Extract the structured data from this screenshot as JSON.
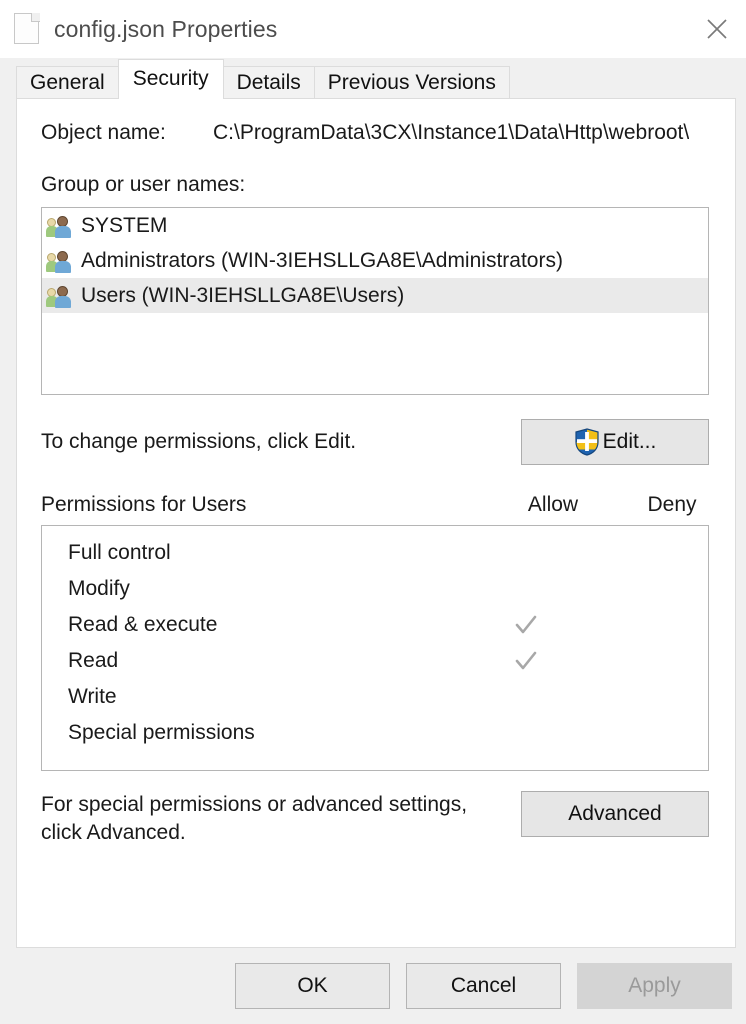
{
  "window": {
    "title": "config.json Properties",
    "file_icon": "document-icon",
    "close_icon": "close-icon"
  },
  "tabs": [
    {
      "label": "General",
      "active": false
    },
    {
      "label": "Security",
      "active": true
    },
    {
      "label": "Details",
      "active": false
    },
    {
      "label": "Previous Versions",
      "active": false
    }
  ],
  "security": {
    "object_name_label": "Object name:",
    "object_name_value": "C:\\ProgramData\\3CX\\Instance1\\Data\\Http\\webroot\\",
    "group_label": "Group or user names:",
    "users": [
      {
        "name": "SYSTEM",
        "selected": false,
        "icon": "group-users-icon"
      },
      {
        "name": "Administrators (WIN-3IEHSLLGA8E\\Administrators)",
        "selected": false,
        "icon": "group-users-icon"
      },
      {
        "name": "Users (WIN-3IEHSLLGA8E\\Users)",
        "selected": true,
        "icon": "group-users-icon"
      }
    ],
    "edit_hint": "To change permissions, click Edit.",
    "edit_button": "Edit...",
    "edit_button_icon": "uac-shield-icon",
    "permissions_title": "Permissions for Users",
    "column_allow": "Allow",
    "column_deny": "Deny",
    "permissions": [
      {
        "name": "Full control",
        "allow": false,
        "deny": false
      },
      {
        "name": "Modify",
        "allow": false,
        "deny": false
      },
      {
        "name": "Read & execute",
        "allow": true,
        "deny": false
      },
      {
        "name": "Read",
        "allow": true,
        "deny": false
      },
      {
        "name": "Write",
        "allow": false,
        "deny": false
      },
      {
        "name": "Special permissions",
        "allow": false,
        "deny": false
      }
    ],
    "advanced_hint_line1": "For special permissions or advanced settings,",
    "advanced_hint_line2": "click Advanced.",
    "advanced_button": "Advanced"
  },
  "footer": {
    "ok": "OK",
    "cancel": "Cancel",
    "apply": "Apply",
    "apply_disabled": true
  },
  "colors": {
    "dialog_bg": "#f0f0f0",
    "panel_bg": "#ffffff",
    "selection": "#eaeaea",
    "check_gray": "#a8a8a8",
    "shield_blue": "#1f63b0",
    "shield_gold": "#f2c018"
  }
}
